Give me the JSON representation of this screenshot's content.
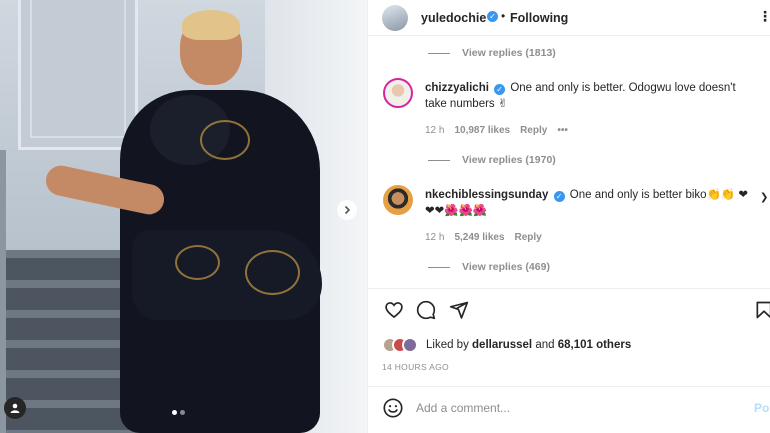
{
  "header": {
    "username": "yuledochie",
    "verified": true,
    "separator": "•",
    "follow_status": "Following",
    "more_icon": "more-horizontal-icon"
  },
  "comments": [
    {
      "view_replies_top": "View replies (1813)"
    },
    {
      "username": "chizzyalichi",
      "verified": true,
      "text": "One and only is better. Odogwu love doesn't take numbers ✌",
      "time": "12 h",
      "likes": "10,987 likes",
      "reply": "Reply",
      "more": "•••",
      "view_replies": "View replies (1970)"
    },
    {
      "username": "nkechiblessingsunday",
      "verified": true,
      "text": "One and only is better biko👏👏 ❤ ❤❤🌺🌺🌺",
      "time": "12 h",
      "likes": "5,249 likes",
      "reply": "Reply",
      "view_replies": "View replies (469)"
    }
  ],
  "actions": {
    "like_icon": "heart-icon",
    "comment_icon": "comment-icon",
    "share_icon": "send-icon",
    "save_icon": "bookmark-icon"
  },
  "likes": {
    "prefix": "Liked by ",
    "user": "dellarussel",
    "middle": " and ",
    "others": "68,101 others"
  },
  "time_ago": "14 HOURS AGO",
  "add_comment": {
    "placeholder": "Add a comment...",
    "post_label": "Pos"
  },
  "colors": {
    "verified_blue": "#3897f0",
    "muted_text": "#8e8e8e",
    "post_disabled": "#b2dffc"
  }
}
